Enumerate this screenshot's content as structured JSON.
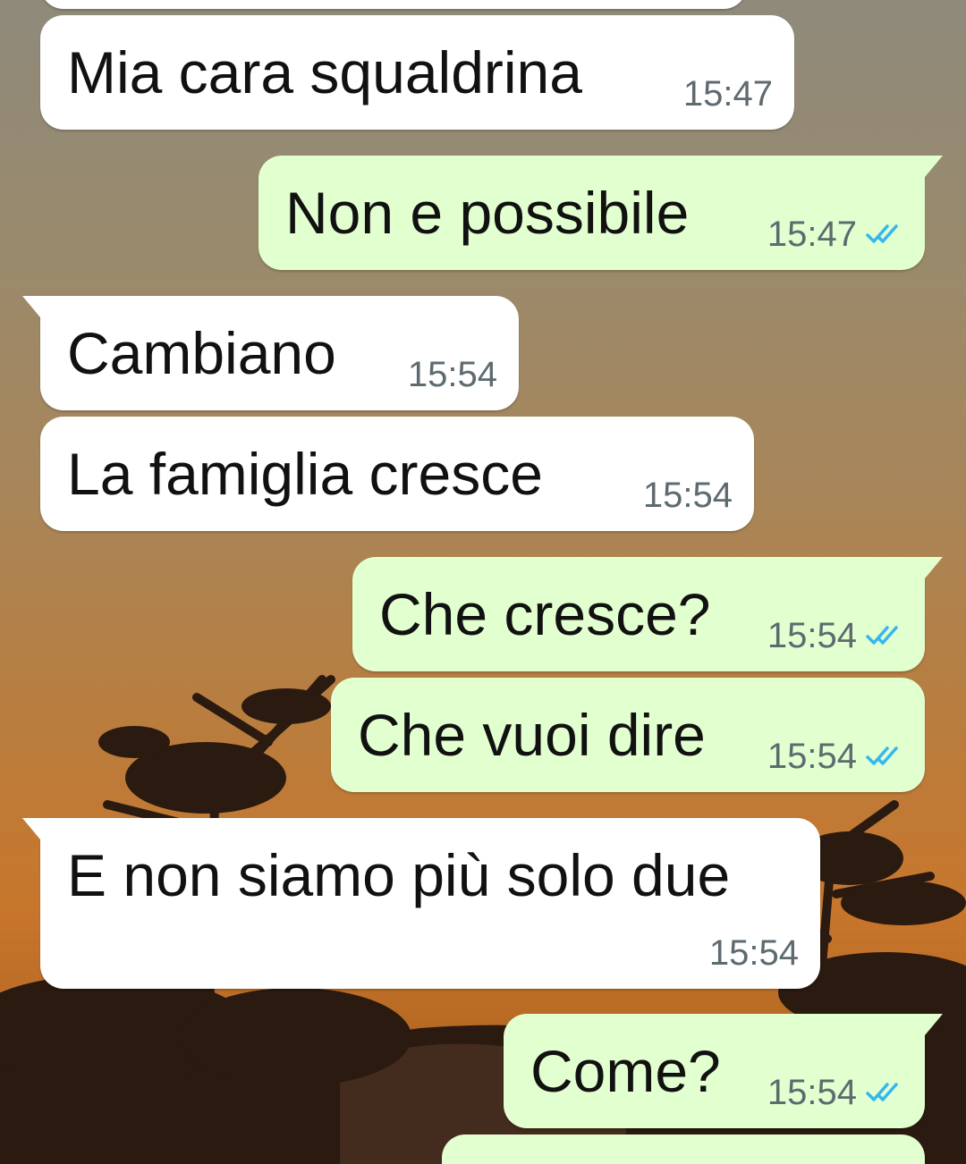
{
  "messages": [
    {
      "text": "",
      "time": "",
      "direction": "incoming"
    },
    {
      "text": "Mia cara squaldrina",
      "time": "15:47",
      "direction": "incoming"
    },
    {
      "text": "Non e possibile",
      "time": "15:47",
      "direction": "outgoing",
      "status": "read-double-check"
    },
    {
      "text": "Cambiano",
      "time": "15:54",
      "direction": "incoming"
    },
    {
      "text": "La famiglia cresce",
      "time": "15:54",
      "direction": "incoming"
    },
    {
      "text": "Che cresce?",
      "time": "15:54",
      "direction": "outgoing",
      "status": "read-double-check"
    },
    {
      "text": "Che vuoi dire",
      "time": "15:54",
      "direction": "outgoing",
      "status": "read-double-check"
    },
    {
      "text": "E non siamo più solo due",
      "time": "15:54",
      "direction": "incoming"
    },
    {
      "text": "Come?",
      "time": "15:54",
      "direction": "outgoing",
      "status": "read-double-check"
    },
    {
      "text": "",
      "time": "",
      "direction": "outgoing"
    }
  ],
  "colors": {
    "incoming_bubble": "#ffffff",
    "outgoing_bubble": "#e2ffcf",
    "read_ticks": "#34b7f1",
    "timestamp": "#5d6b70"
  },
  "icons": {
    "read_receipt": "double-check-icon"
  },
  "wallpaper": "sunset-tree-silhouette"
}
